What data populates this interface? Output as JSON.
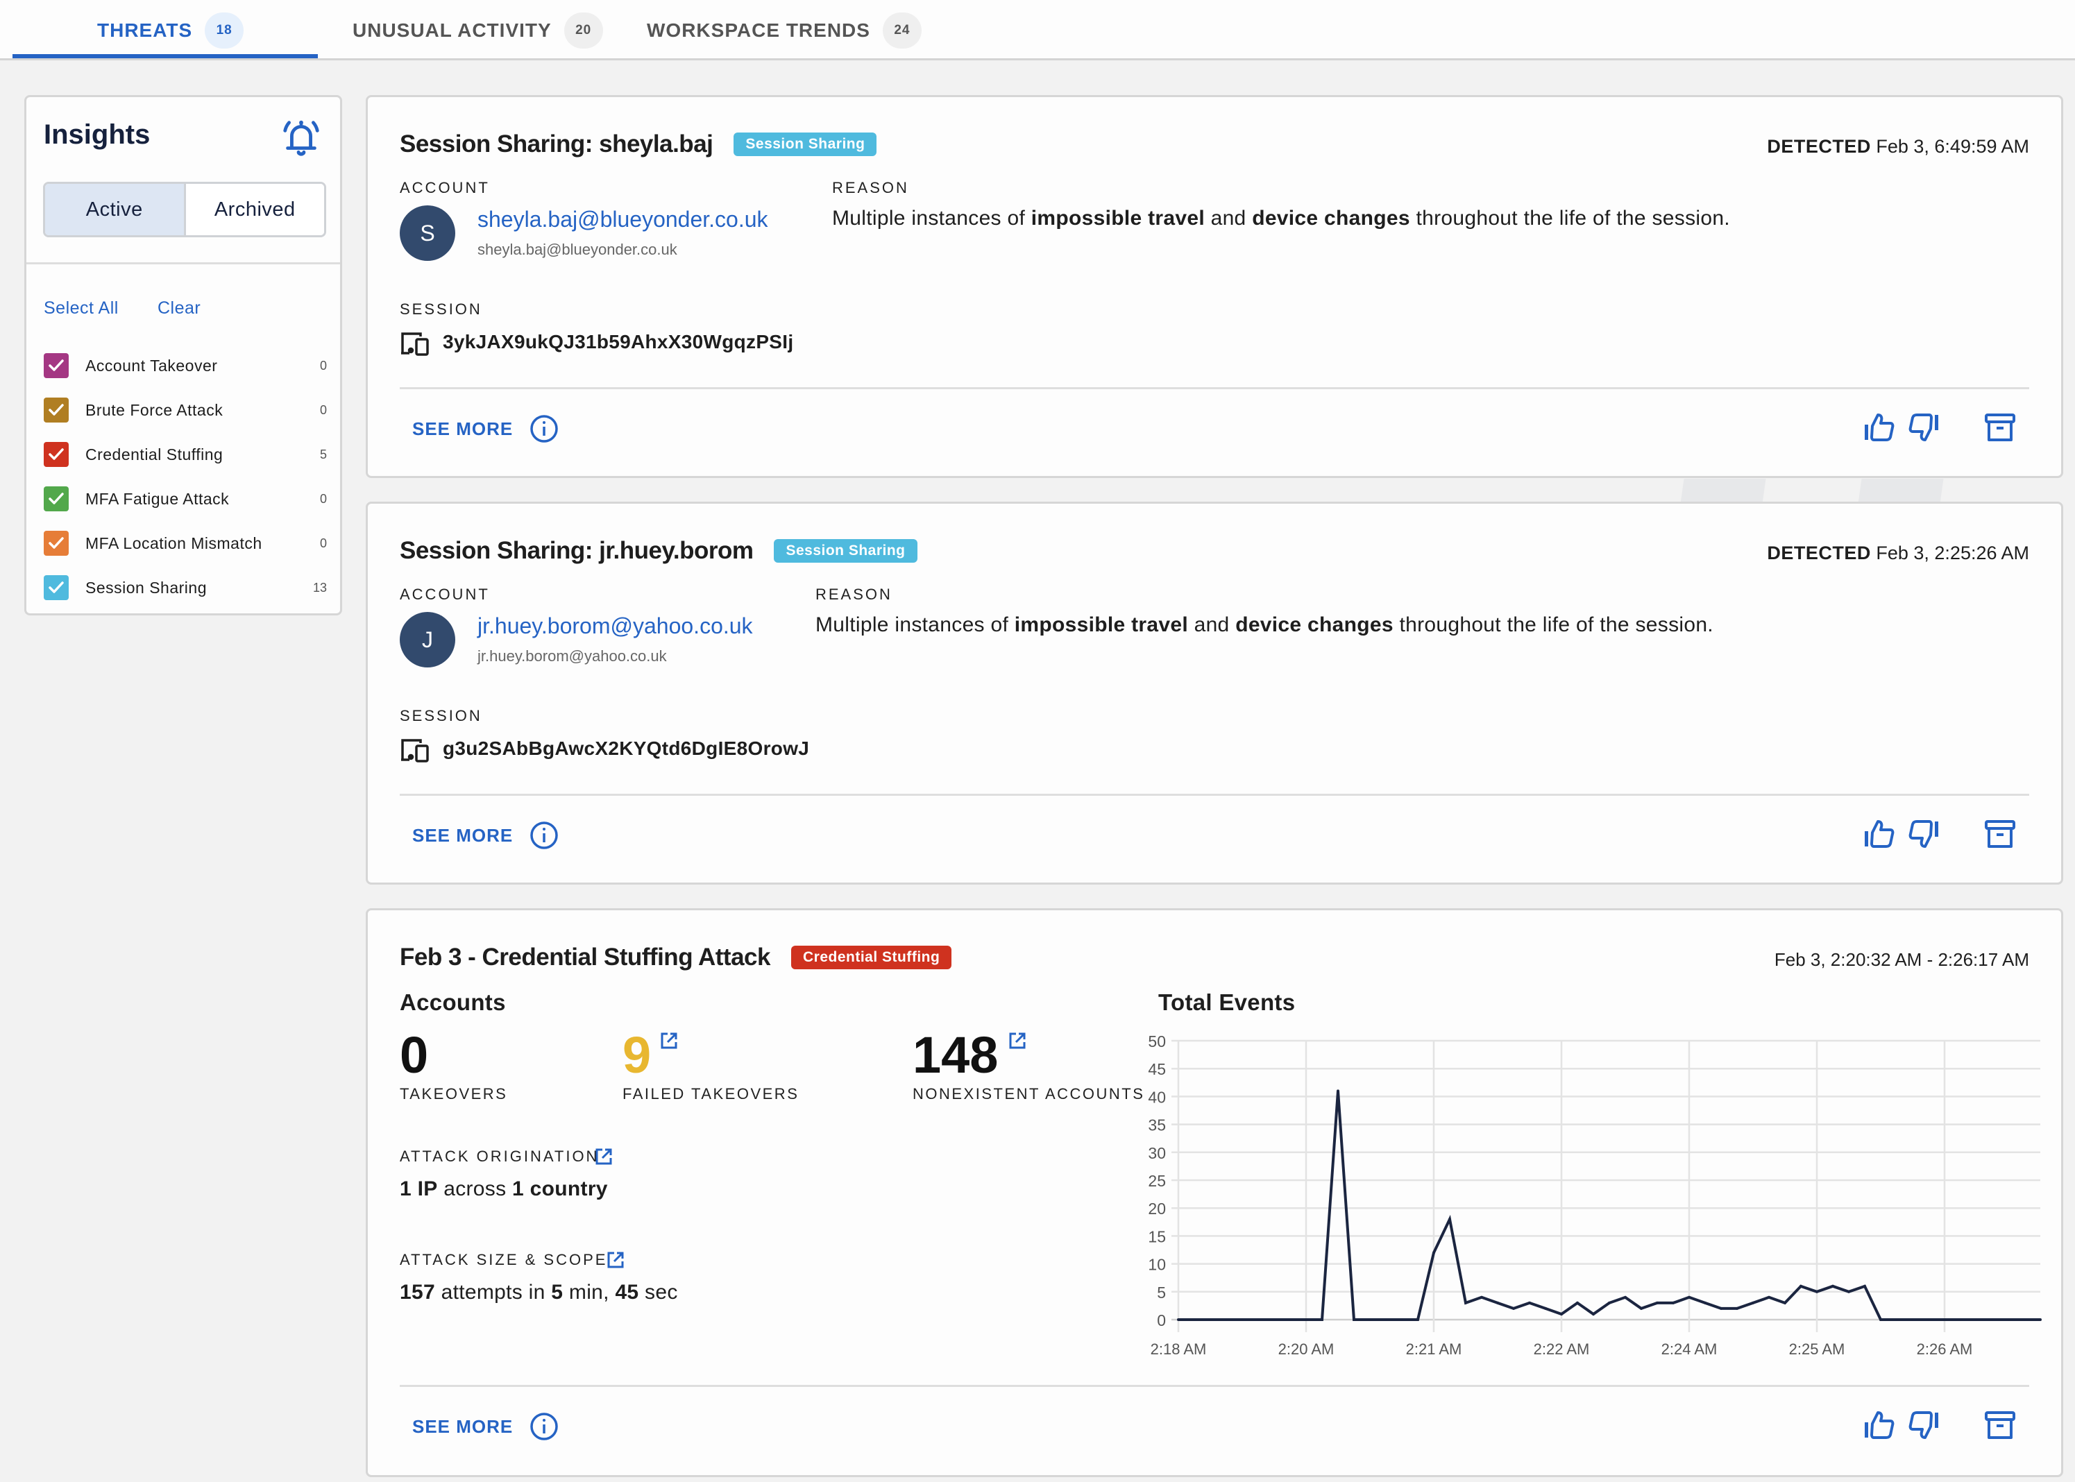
{
  "tabs": [
    {
      "label": "THREATS",
      "count": "18",
      "active": true
    },
    {
      "label": "UNUSUAL ACTIVITY",
      "count": "20",
      "active": false
    },
    {
      "label": "WORKSPACE TRENDS",
      "count": "24",
      "active": false
    }
  ],
  "insights": {
    "title": "Insights",
    "bell_icon": "bell-alert-icon",
    "segments": [
      {
        "label": "Active",
        "active": true
      },
      {
        "label": "Archived",
        "active": false
      }
    ],
    "select_all": "Select All",
    "clear": "Clear",
    "filters": [
      {
        "label": "Account Takeover",
        "count": "0",
        "color": "#a43783",
        "checked": true
      },
      {
        "label": "Brute Force Attack",
        "count": "0",
        "color": "#b07e22",
        "checked": true
      },
      {
        "label": "Credential Stuffing",
        "count": "5",
        "color": "#cf321f",
        "checked": true
      },
      {
        "label": "MFA Fatigue Attack",
        "count": "0",
        "color": "#52a84b",
        "checked": true
      },
      {
        "label": "MFA Location Mismatch",
        "count": "0",
        "color": "#e67d38",
        "checked": true
      },
      {
        "label": "Session Sharing",
        "count": "13",
        "color": "#4fbade",
        "checked": true
      }
    ]
  },
  "colors": {
    "accent": "#2563c4",
    "session_sharing": "#4fbade",
    "credential_stuffing": "#cf321f",
    "warning_number": "#e8b730",
    "avatar": "#324a6d",
    "chart_line": "#1b2540"
  },
  "cards": [
    {
      "title": "Session Sharing: sheyla.baj",
      "badge": "Session Sharing",
      "detected_label": "DETECTED",
      "detected_time": "Feb 3, 6:49:59 AM",
      "account_label": "ACCOUNT",
      "avatar_letter": "S",
      "email": "sheyla.baj@blueyonder.co.uk",
      "email_sub": "sheyla.baj@blueyonder.co.uk",
      "reason_label": "REASON",
      "reason": {
        "pre": "Multiple instances of ",
        "b1": "impossible travel",
        "mid": " and ",
        "b2": "device changes",
        "post": " throughout the life of the session."
      },
      "session_label": "SESSION",
      "session_id": "3ykJAX9ukQJ31b59AhxX30WgqzPSIj",
      "see_more": "SEE MORE"
    },
    {
      "title": "Session Sharing: jr.huey.borom",
      "badge": "Session Sharing",
      "detected_label": "DETECTED",
      "detected_time": "Feb 3, 2:25:26 AM",
      "account_label": "ACCOUNT",
      "avatar_letter": "J",
      "email": "jr.huey.borom@yahoo.co.uk",
      "email_sub": "jr.huey.borom@yahoo.co.uk",
      "reason_label": "REASON",
      "reason": {
        "pre": "Multiple instances of ",
        "b1": "impossible travel",
        "mid": " and ",
        "b2": "device changes",
        "post": " throughout the life of the session."
      },
      "session_label": "SESSION",
      "session_id": "g3u2SAbBgAwcX2KYQtd6DgIE8OrowJ",
      "see_more": "SEE MORE"
    }
  ],
  "credential_card": {
    "title": "Feb 3 - Credential Stuffing Attack",
    "badge": "Credential Stuffing",
    "time_range": "Feb 3, 2:20:32 AM - 2:26:17 AM",
    "accounts_title": "Accounts",
    "takeovers": {
      "value": "0",
      "label": "TAKEOVERS"
    },
    "failed_takeovers": {
      "value": "9",
      "label": "FAILED TAKEOVERS"
    },
    "nonexistent": {
      "value": "148",
      "label": "NONEXISTENT ACCOUNTS"
    },
    "origination_label": "ATTACK ORIGINATION",
    "origination": {
      "n1": "1",
      "w1": " IP",
      "mid": " across ",
      "n2": "1",
      "w2": " country"
    },
    "scope_label": "ATTACK SIZE & SCOPE",
    "scope": {
      "attempts": "157",
      "t1": " attempts in ",
      "min": "5",
      "t2": " min, ",
      "sec": "45",
      "t3": " sec"
    },
    "see_more": "SEE MORE"
  },
  "chart_data": {
    "type": "line",
    "title": "Total Events",
    "xlabel": "",
    "ylabel": "",
    "ylim": [
      0,
      50
    ],
    "yticks": [
      0,
      5,
      10,
      15,
      20,
      25,
      30,
      35,
      40,
      45,
      50
    ],
    "grid": true,
    "x_tick_labels": [
      {
        "index": 0,
        "label": "2:18 AM"
      },
      {
        "index": 8,
        "label": "2:20 AM"
      },
      {
        "index": 16,
        "label": "2:21 AM"
      },
      {
        "index": 24,
        "label": "2:22 AM"
      },
      {
        "index": 32,
        "label": "2:24 AM"
      },
      {
        "index": 40,
        "label": "2:25 AM"
      },
      {
        "index": 48,
        "label": "2:26 AM"
      }
    ],
    "series": [
      {
        "name": "Total Events",
        "values": [
          0,
          0,
          0,
          0,
          0,
          0,
          0,
          0,
          0,
          0,
          41,
          0,
          0,
          0,
          0,
          0,
          12,
          18,
          3,
          4,
          3,
          2,
          3,
          2,
          1,
          3,
          1,
          3,
          4,
          2,
          3,
          3,
          4,
          3,
          2,
          2,
          3,
          4,
          3,
          6,
          5,
          6,
          5,
          6,
          0,
          0,
          0,
          0,
          0,
          0,
          0,
          0,
          0,
          0,
          0
        ]
      }
    ]
  }
}
